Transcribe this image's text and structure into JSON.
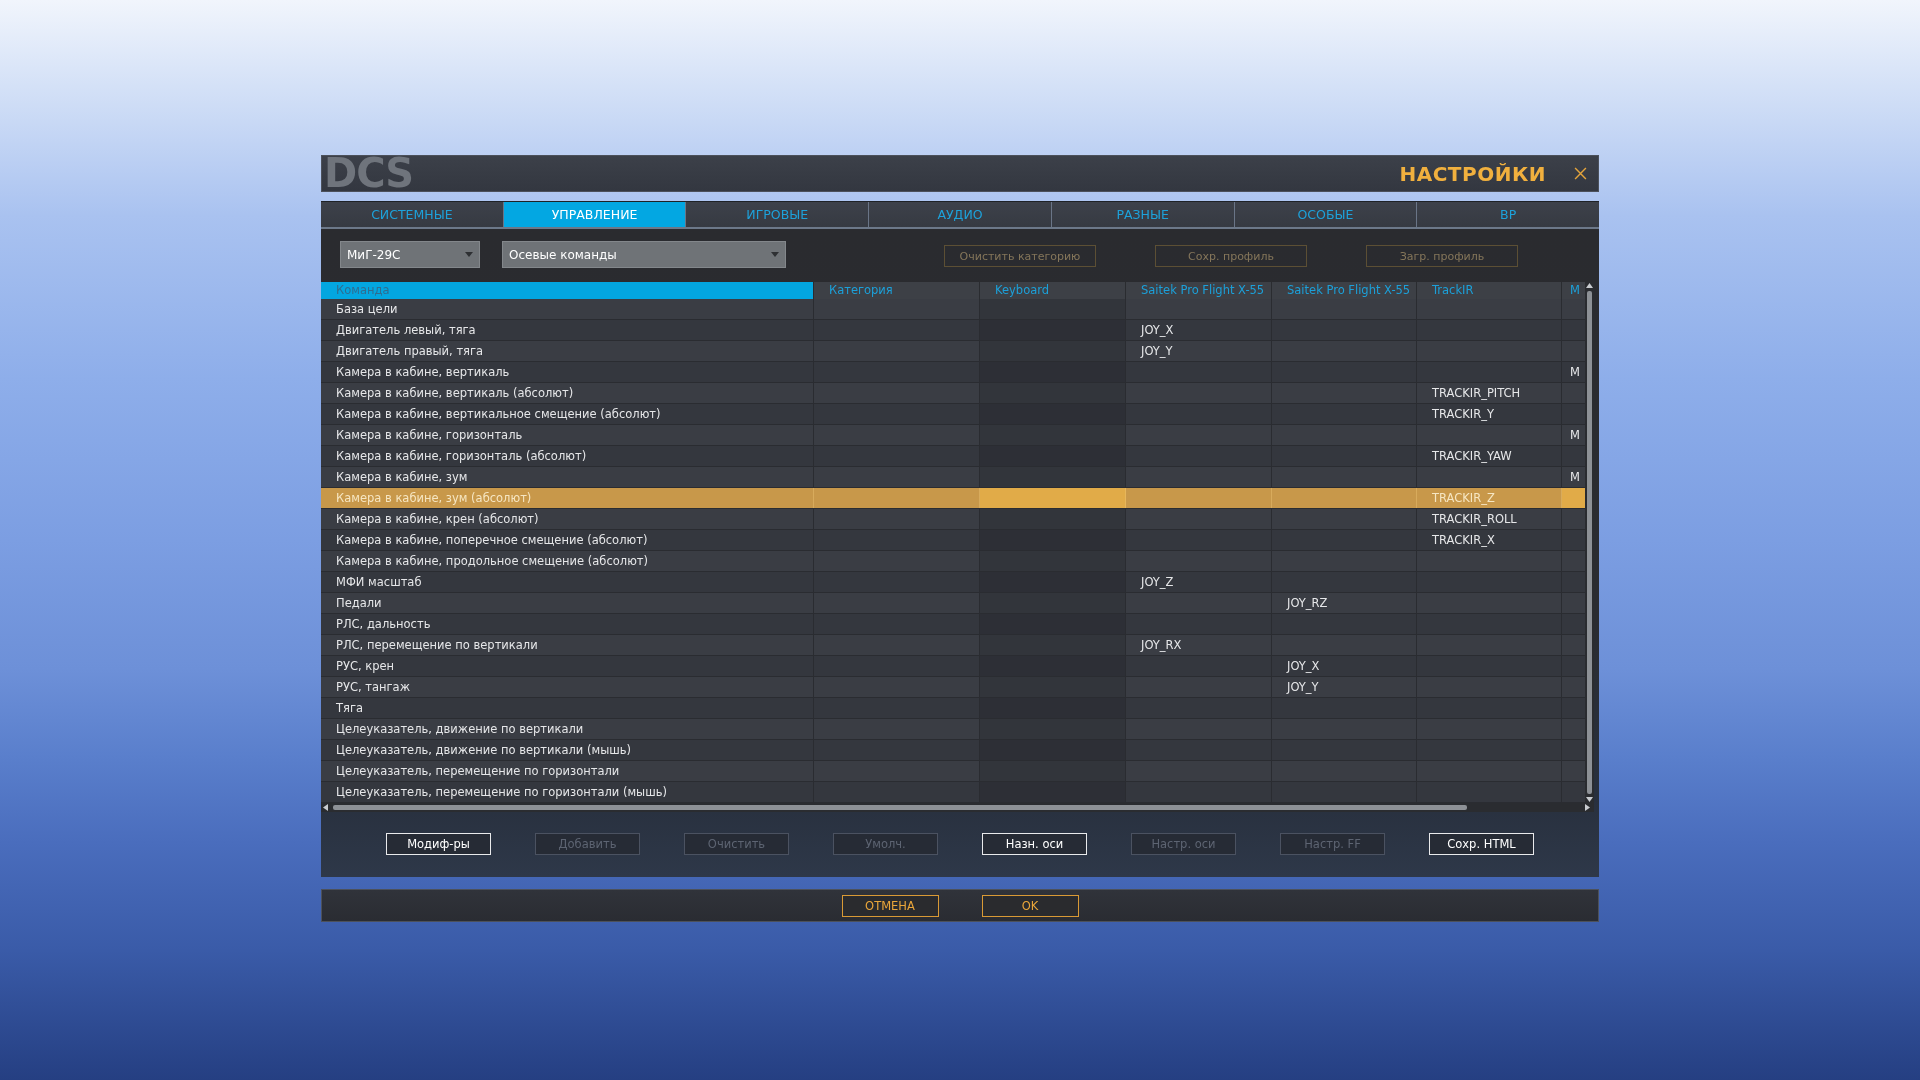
{
  "window": {
    "logo": "DCS",
    "title": "НАСТРОЙКИ"
  },
  "tabs": [
    {
      "label": "СИСТЕМНЫЕ",
      "selected": false
    },
    {
      "label": "УПРАВЛЕНИЕ",
      "selected": true
    },
    {
      "label": "ИГРОВЫЕ",
      "selected": false
    },
    {
      "label": "АУДИО",
      "selected": false
    },
    {
      "label": "РАЗНЫЕ",
      "selected": false
    },
    {
      "label": "ОСОБЫЕ",
      "selected": false
    },
    {
      "label": "ВР",
      "selected": false
    }
  ],
  "toolbar": {
    "dropdowns": [
      {
        "value": "МиГ-29С"
      },
      {
        "value": "Осевые команды"
      }
    ],
    "buttons": [
      {
        "label": "Очистить категорию",
        "disabled": true
      },
      {
        "label": "Сохр. профиль",
        "disabled": true
      },
      {
        "label": "Загр. профиль",
        "disabled": true
      }
    ]
  },
  "table": {
    "columns": [
      {
        "label": "Команда",
        "selected": true
      },
      {
        "label": "Категория",
        "selected": false
      },
      {
        "label": "Keyboard",
        "selected": false
      },
      {
        "label": "Saitek Pro Flight X-55",
        "selected": false
      },
      {
        "label": "Saitek Pro Flight X-55",
        "selected": false
      },
      {
        "label": "TrackIR",
        "selected": false
      },
      {
        "label": "M",
        "selected": false
      }
    ],
    "rows": [
      {
        "command": "База цели",
        "selected": false
      },
      {
        "command": "Двигатель левый, тяга",
        "saitek_1": "JOY_X",
        "selected": false
      },
      {
        "command": "Двигатель правый, тяга",
        "saitek_1": "JOY_Y",
        "selected": false
      },
      {
        "command": "Камера в кабине, вертикаль",
        "column_7": "M",
        "selected": false
      },
      {
        "command": "Камера в кабине, вертикаль (абсолют)",
        "trackir": "TRACKIR_PITCH",
        "selected": false
      },
      {
        "command": "Камера в кабине, вертикальное смещение (абсолют)",
        "trackir": "TRACKIR_Y",
        "selected": false
      },
      {
        "command": "Камера в кабине, горизонталь",
        "column_7": "M",
        "selected": false
      },
      {
        "command": "Камера в кабине, горизонталь (абсолют)",
        "trackir": "TRACKIR_YAW",
        "selected": false
      },
      {
        "command": "Камера в кабине, зум",
        "column_7": "M",
        "selected": false
      },
      {
        "command": "Камера в кабине, зум (абсолют)",
        "trackir": "TRACKIR_Z",
        "selected": true
      },
      {
        "command": "Камера в кабине, крен (абсолют)",
        "trackir": "TRACKIR_ROLL",
        "selected": false
      },
      {
        "command": "Камера в кабине, поперечное смещение (абсолют)",
        "trackir": "TRACKIR_X",
        "selected": false
      },
      {
        "command": "Камера в кабине, продольное смещение (абсолют)",
        "selected": false
      },
      {
        "command": "МФИ масштаб",
        "saitek_1": "JOY_Z",
        "selected": false
      },
      {
        "command": "Педали",
        "saitek_2": "JOY_RZ",
        "selected": false
      },
      {
        "command": "РЛС, дальность",
        "selected": false
      },
      {
        "command": "РЛС, перемещение по вертикали",
        "saitek_1": "JOY_RX",
        "selected": false
      },
      {
        "command": "РУС, крен",
        "saitek_2": "JOY_X",
        "selected": false
      },
      {
        "command": "РУС, тангаж",
        "saitek_2": "JOY_Y",
        "selected": false
      },
      {
        "command": "Тяга",
        "selected": false
      },
      {
        "command": "Целеуказатель, движение по вертикали",
        "selected": false
      },
      {
        "command": "Целеуказатель, движение по вертикали (мышь)",
        "selected": false
      },
      {
        "command": "Целеуказатель, перемещение по горизонтали",
        "selected": false
      },
      {
        "command": "Целеуказатель, перемещение по горизонтали (мышь)",
        "selected": false
      }
    ]
  },
  "actions": [
    {
      "label": "Модиф-ры",
      "disabled": false
    },
    {
      "label": "Добавить",
      "disabled": true
    },
    {
      "label": "Очистить",
      "disabled": true
    },
    {
      "label": "Умолч.",
      "disabled": true
    },
    {
      "label": "Назн. оси",
      "disabled": false
    },
    {
      "label": "Настр. оси",
      "disabled": true
    },
    {
      "label": "Настр. FF",
      "disabled": true
    },
    {
      "label": "Сохр. HTML",
      "disabled": false
    }
  ],
  "footer_buttons": [
    "ОТМЕНА",
    "OK"
  ]
}
